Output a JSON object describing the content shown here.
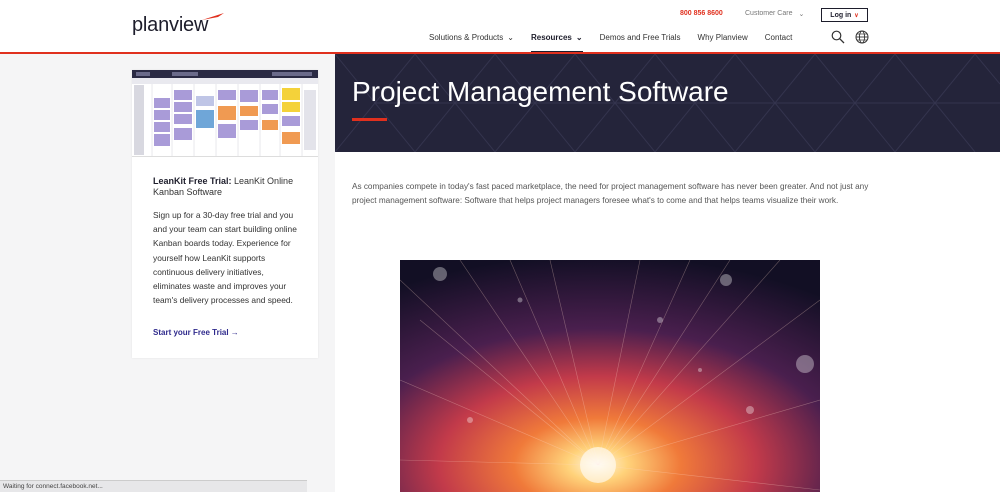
{
  "brand": {
    "logo_text": "planview",
    "accent": "#e0301e",
    "dark": "#24243a"
  },
  "topbar": {
    "phone": "800 856 8600",
    "customer_care": "Customer Care",
    "login": "Log in"
  },
  "nav": {
    "items": [
      {
        "label": "Solutions & Products",
        "has_dropdown": true
      },
      {
        "label": "Resources",
        "has_dropdown": true,
        "active": true
      },
      {
        "label": "Demos and Free Trials",
        "has_dropdown": false
      },
      {
        "label": "Why Planview",
        "has_dropdown": false
      },
      {
        "label": "Contact",
        "has_dropdown": false
      }
    ],
    "icons": [
      "search-icon",
      "globe-icon"
    ]
  },
  "hero": {
    "title": "Project Management Software"
  },
  "intro": {
    "text": "As companies compete in today's fast paced marketplace, the need for project management software has never been greater. And not just any project management software: Software that helps project managers foresee what's to come and that helps teams visualize their work."
  },
  "sidebar_card": {
    "title_bold": "LeanKit Free Trial:",
    "title_rest": " LeanKit Online Kanban Software",
    "body": "Sign up for a 30-day free trial and you and your team can start building online Kanban boards today. Experience for yourself how LeanKit supports continuous delivery initiatives, eliminates waste and improves your team's delivery processes and speed.",
    "cta": "Start your Free Trial →"
  },
  "status_bar": {
    "text": "Waiting for connect.facebook.net..."
  }
}
